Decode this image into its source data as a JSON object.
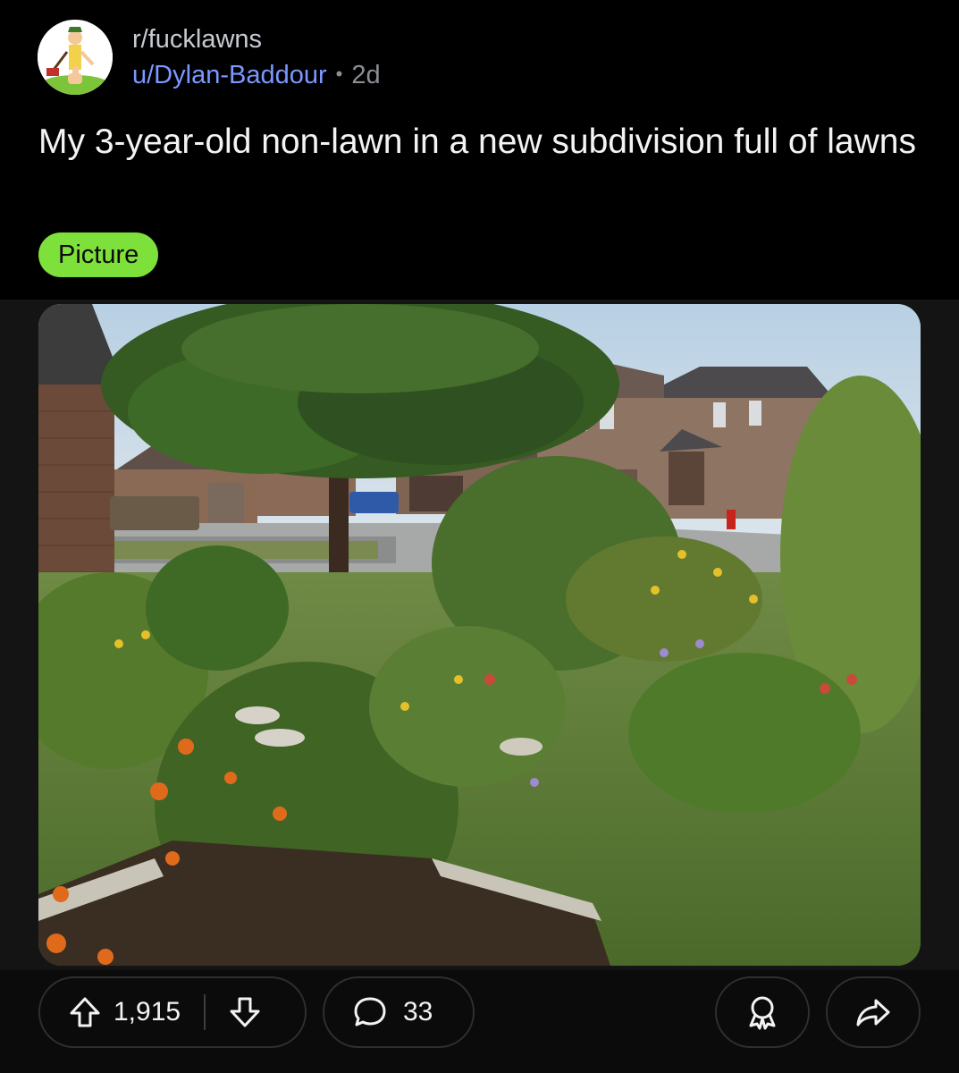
{
  "post": {
    "subreddit": "r/fucklawns",
    "username": "u/Dylan-Baddour",
    "separator": "•",
    "age": "2d",
    "title": "My 3-year-old non-lawn in a new subdivision full of lawns",
    "flair": "Picture",
    "flair_color": "#7ee03a"
  },
  "actions": {
    "upvotes": "1,915",
    "comments": "33",
    "upvote_icon": "arrow-up-icon",
    "downvote_icon": "arrow-down-icon",
    "comment_icon": "speech-bubble-icon",
    "award_icon": "award-ribbon-icon",
    "share_icon": "share-arrow-icon"
  },
  "colors": {
    "background": "#000000",
    "username": "#7b98ff",
    "text": "#f2f3f5",
    "muted": "#8a8f96"
  }
}
